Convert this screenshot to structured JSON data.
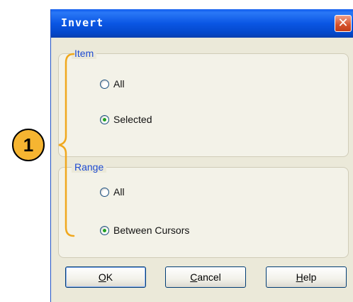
{
  "dialog": {
    "title": "Invert",
    "close_label": "✕",
    "item_group": {
      "label": "Item",
      "options": [
        "All",
        "Selected"
      ],
      "selected": "Selected"
    },
    "range_group": {
      "label": "Range",
      "options": [
        "All",
        "Between Cursors"
      ],
      "selected": "Between Cursors"
    },
    "buttons": {
      "ok": {
        "mnemonic": "O",
        "rest": "K"
      },
      "cancel": {
        "mnemonic": "C",
        "rest": "ancel"
      },
      "help": {
        "mnemonic": "H",
        "rest": "elp"
      }
    }
  },
  "annotation": {
    "callout_number": "1",
    "bracket_color": "#f0a81e"
  },
  "colors": {
    "titlebar": "#0a56e4",
    "dialog_bg": "#ebe9d9",
    "group_label": "#1e4bd2",
    "radio_checked": "#21a121"
  }
}
